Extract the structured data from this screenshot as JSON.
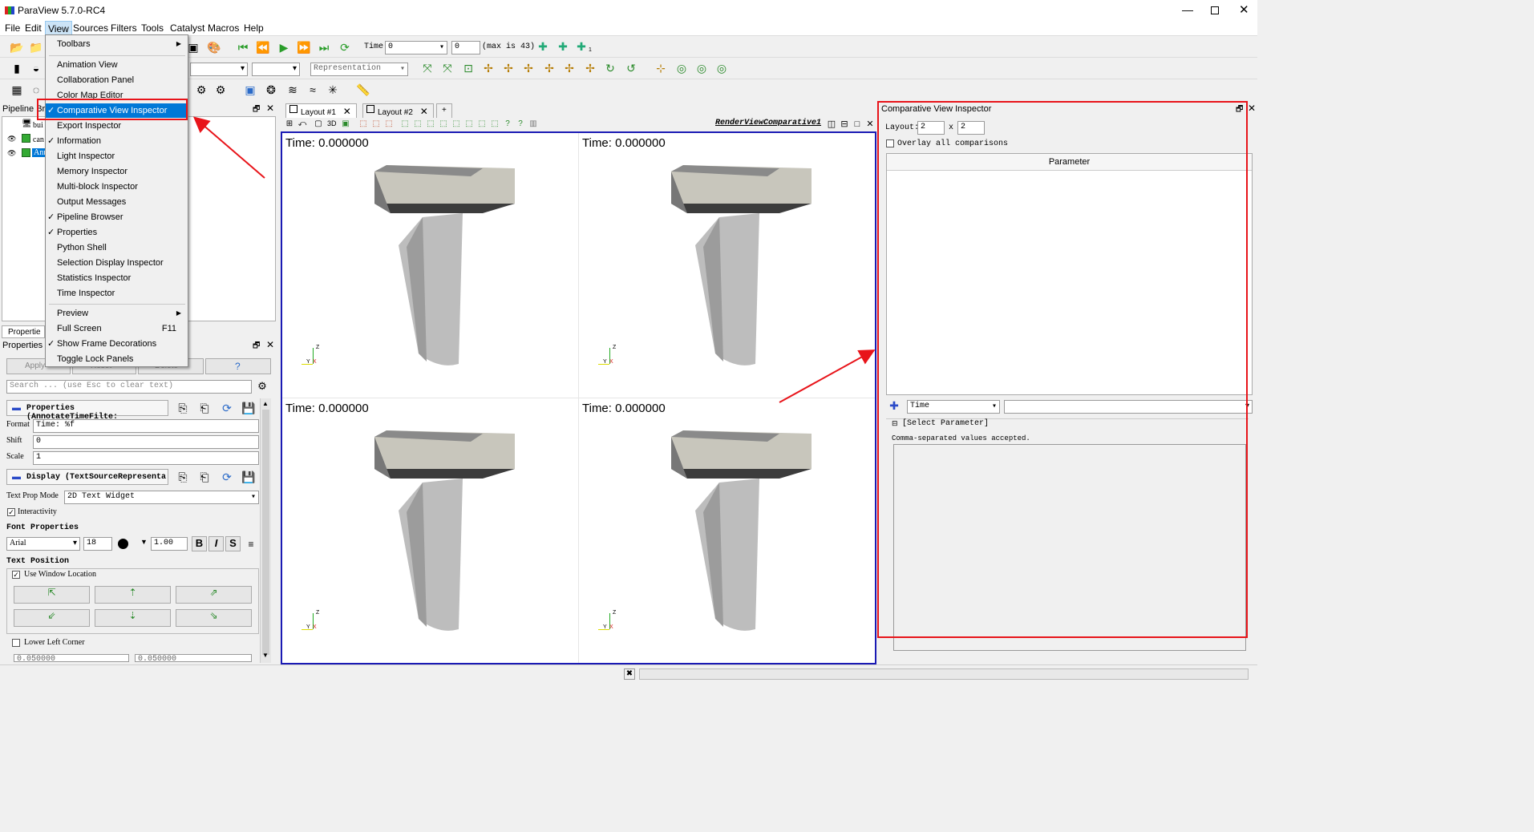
{
  "window": {
    "title": "ParaView 5.7.0-RC4"
  },
  "menubar": [
    "File",
    "Edit",
    "View",
    "Sources",
    "Filters",
    "Tools",
    "Catalyst",
    "Macros",
    "Help"
  ],
  "toolbar": {
    "time_label": "Time:",
    "time_value": "0",
    "step_value": "0",
    "max_label": "(max is 43)",
    "representation": "Representation",
    "zoom_badge": "1"
  },
  "view_menu": {
    "items": [
      {
        "label": "Toolbars",
        "checked": false,
        "submenu": true
      },
      {
        "label": "Animation View",
        "checked": false
      },
      {
        "label": "Collaboration Panel",
        "checked": false
      },
      {
        "label": "Color Map Editor",
        "checked": false
      },
      {
        "label": "Comparative View Inspector",
        "checked": true,
        "highlighted": true
      },
      {
        "label": "Export Inspector",
        "checked": false
      },
      {
        "label": "Information",
        "checked": true
      },
      {
        "label": "Light Inspector",
        "checked": false
      },
      {
        "label": "Memory Inspector",
        "checked": false
      },
      {
        "label": "Multi-block Inspector",
        "checked": false
      },
      {
        "label": "Output Messages",
        "checked": false
      },
      {
        "label": "Pipeline Browser",
        "checked": true
      },
      {
        "label": "Properties",
        "checked": true
      },
      {
        "label": "Python Shell",
        "checked": false
      },
      {
        "label": "Selection Display Inspector",
        "checked": false
      },
      {
        "label": "Statistics Inspector",
        "checked": false
      },
      {
        "label": "Time Inspector",
        "checked": false
      },
      {
        "label": "Preview",
        "checked": false,
        "submenu": true
      },
      {
        "label": "Full Screen",
        "checked": false,
        "shortcut": "F11"
      },
      {
        "label": "Show Frame Decorations",
        "checked": true
      },
      {
        "label": "Toggle Lock Panels",
        "checked": false
      }
    ]
  },
  "pipeline": {
    "title": "Pipeline Br",
    "items": [
      "bui",
      "can",
      "Ann"
    ]
  },
  "properties": {
    "tab_small": "Propertie",
    "title": "Properties",
    "apply": "Apply",
    "reset": "Reset",
    "delete": "Delete",
    "help": "?",
    "search_placeholder": "Search ... (use Esc to clear text)",
    "section1": "Properties (AnnotateTimeFilte:",
    "format_label": "Format",
    "format_value": "Time: %f",
    "shift_label": "Shift",
    "shift_value": "0",
    "scale_label": "Scale",
    "scale_value": "1",
    "section2": "Display (TextSourceRepresenta",
    "textprop_label": "Text Prop Mode",
    "textprop_value": "2D Text Widget",
    "interactivity": "Interactivity",
    "font_props": "Font Properties",
    "font_family": "Arial",
    "font_size": "18",
    "opacity": "1.00",
    "bold": "B",
    "italic": "I",
    "shadow": "S",
    "text_position": "Text Position",
    "use_window_location": "Use Window Location",
    "lower_left": "Lower Left Corner",
    "coord_x": "0.050000",
    "coord_y": "0.050000"
  },
  "layout_tabs": [
    "Layout #1",
    "Layout #2",
    "+"
  ],
  "view": {
    "title": "RenderViewComparative1",
    "time_labels": [
      "Time: 0.000000",
      "Time: 0.000000",
      "Time: 0.000000",
      "Time: 0.000000"
    ],
    "axis": {
      "x": "X",
      "y": "Y",
      "z": "Z"
    }
  },
  "cvi": {
    "title": "Comparative View Inspector",
    "layout_label": "Layout:",
    "layout_x": "2",
    "times": "x",
    "layout_y": "2",
    "overlay": "Overlay all comparisons",
    "param_header": "Parameter",
    "time_combo": "Time",
    "select_param": "[Select Parameter]",
    "csv_note": "Comma-separated values accepted."
  },
  "colors": {
    "highlight": "#0078d7",
    "annotation": "#e8141a",
    "view_border": "#1a1ab4"
  }
}
